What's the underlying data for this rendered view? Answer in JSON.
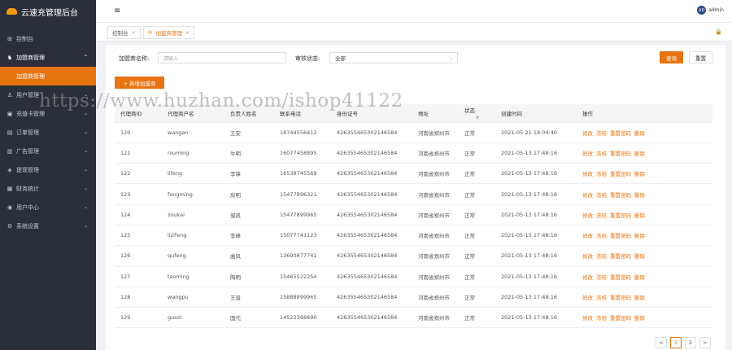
{
  "app": {
    "title": "云速充管理后台"
  },
  "header": {
    "menu_icon": "≡",
    "username": "admin",
    "avatar_text": "AD"
  },
  "sidebar": {
    "items": [
      {
        "label": "控制台",
        "icon": "⊞",
        "arrow": ""
      },
      {
        "label": "加盟商管理",
        "icon": "♞",
        "arrow": "⌃",
        "open": true
      },
      {
        "label": "加盟商管理",
        "sub": true
      },
      {
        "label": "用户管理",
        "icon": "♙",
        "arrow": "⌄"
      },
      {
        "label": "充值卡管理",
        "icon": "▣",
        "arrow": "⌄"
      },
      {
        "label": "订单管理",
        "icon": "▤",
        "arrow": "⌄"
      },
      {
        "label": "广告管理",
        "icon": "▥",
        "arrow": "⌄"
      },
      {
        "label": "提现管理",
        "icon": "◈",
        "arrow": "⌄"
      },
      {
        "label": "财务统计",
        "icon": "▦",
        "arrow": "⌄"
      },
      {
        "label": "用户中心",
        "icon": "◉",
        "arrow": "⌄"
      },
      {
        "label": "系统设置",
        "icon": "⚙",
        "arrow": "⌄"
      }
    ]
  },
  "tabs": [
    {
      "label": "控制台",
      "close": "×"
    },
    {
      "label": "加盟商管理",
      "close": "×",
      "icon": "⟳"
    }
  ],
  "filters": {
    "name_label": "加盟商名称:",
    "name_placeholder": "请输入",
    "status_label": "审核状态:",
    "status_value": "全部",
    "query_button": "查询",
    "reset_button": "重置",
    "add_button": "+ 新增加盟商"
  },
  "table": {
    "columns": [
      "代理商ID",
      "代理商户名",
      "负责人姓名",
      "联系电话",
      "身份证号",
      "地址",
      "状态",
      "",
      "创建时间",
      "操作"
    ],
    "actions": [
      "修改",
      "冻结",
      "重置密码",
      "删除"
    ],
    "action_icons": [
      "⊘",
      "⊘",
      "",
      ""
    ],
    "rows": [
      [
        "120",
        "wangan",
        "王安",
        "18744556412",
        "426355465302146584",
        "河南省郑州市",
        "正常",
        "",
        "2021-05-21 18:04:40"
      ],
      [
        "121",
        "niuming",
        "牛明",
        "16077458895",
        "426355465302146584",
        "河南省郑州市",
        "正常",
        "",
        "2021-05-13 17:48:16"
      ],
      [
        "122",
        "lifeng",
        "李锋",
        "16538745569",
        "426355465302146584",
        "河南省郑州市",
        "正常",
        "",
        "2021-05-13 17:48:16"
      ],
      [
        "123",
        "fangming",
        "房明",
        "15477896321",
        "426355465302146584",
        "河南省郑州市",
        "正常",
        "",
        "2021-05-13 17:48:16"
      ],
      [
        "124",
        "zoukai",
        "邹凯",
        "15477899965",
        "426355465302146584",
        "河南省郑州市",
        "正常",
        "",
        "2021-05-13 17:48:16"
      ],
      [
        "125",
        "lizifeng",
        "李峰",
        "15077741123",
        "426355465302146584",
        "河南省郑州市",
        "正常",
        "",
        "2021-05-13 17:48:16"
      ],
      [
        "126",
        "qufeng",
        "曲风",
        "13690877741",
        "426355465302146584",
        "河南省郑州市",
        "正常",
        "",
        "2021-05-13 17:48:16"
      ],
      [
        "127",
        "taoming",
        "陶明",
        "15465522254",
        "426355465302146584",
        "河南省郑州市",
        "正常",
        "",
        "2021-05-13 17:48:16"
      ],
      [
        "128",
        "wangpu",
        "王普",
        "15888899965",
        "426355465302146584",
        "河南省郑州市",
        "正常",
        "",
        "2021-05-13 17:48:16"
      ],
      [
        "129",
        "guozi",
        "国代",
        "14522366690",
        "426355465302146584",
        "河南省郑州市",
        "正常",
        "",
        "2021-05-13 17:48:16"
      ]
    ]
  },
  "pagination": {
    "prev": "<",
    "pages": [
      "1",
      "2"
    ],
    "next": ">",
    "current": "1"
  },
  "watermark": "https://www.huzhan.com/ishop41122",
  "colors": {
    "accent": "#e87311",
    "sidebar": "#2b2f3a"
  }
}
